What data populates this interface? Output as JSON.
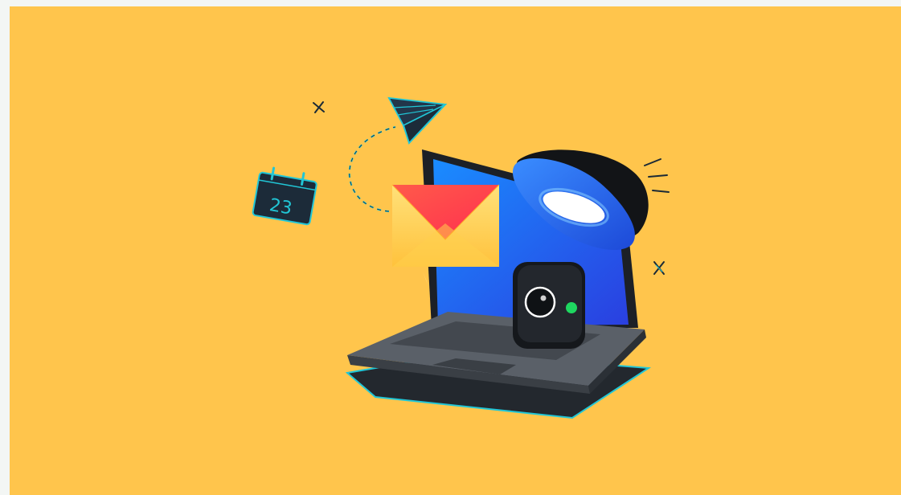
{
  "illustration": {
    "calendar_day": "23",
    "icons": [
      "paper-plane-icon",
      "calendar-icon",
      "envelope-icon",
      "lamp-icon",
      "webcam-icon",
      "laptop-icon",
      "sparkle-icon",
      "cross-icon"
    ],
    "colors": {
      "background": "#ffc54c",
      "outer_border": "#f3f6f4",
      "laptop_body": "#3b3f45",
      "laptop_screen": "#1e6cf0",
      "accent_outline": "#21c6d6",
      "envelope_top": "#ff4a4a",
      "envelope_body": "#ffd35a",
      "webcam_light": "#1ed760"
    }
  }
}
